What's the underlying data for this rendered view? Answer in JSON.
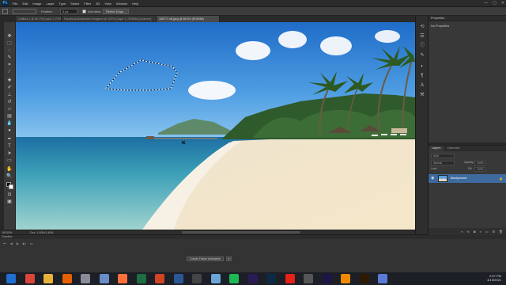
{
  "app": {
    "logo": "Ps",
    "menus": [
      "File",
      "Edit",
      "Image",
      "Layer",
      "Type",
      "Select",
      "Filter",
      "3D",
      "View",
      "Window",
      "Help"
    ],
    "window_controls": [
      "—",
      "▢",
      "✕"
    ]
  },
  "options_bar": {
    "feather_label": "Feather:",
    "feather_value": "0 px",
    "antialias_label": "Anti-alias",
    "refine_edge_label": "Refine Edge..."
  },
  "tabs": [
    {
      "label": "Untitled-1 @ 66.7% (Layer 1, RGB/8#)",
      "active": false
    },
    {
      "label": "Facebook-Bookmark-Designed @ 100% (Layer 1, RGB/8#) [Indexed]",
      "active": false
    },
    {
      "label": "168771 n$.jpeg @ 86.5% (RGB/8#)",
      "active": true
    }
  ],
  "status": {
    "zoom": "86.55%",
    "doc": "Doc: 1.40M/1.40M"
  },
  "timeline": {
    "title": "Timeline",
    "create_button": "Create Frame Animation",
    "controls": [
      "⏮",
      "◀",
      "▶",
      "▶|",
      "⏭"
    ]
  },
  "properties": {
    "title": "Properties",
    "subtitle": "No Properties"
  },
  "layers": {
    "tabs": [
      "Layers",
      "Channels"
    ],
    "kind_label": "Kind",
    "blend_mode": "Normal",
    "opacity_label": "Opacity:",
    "opacity_value": "100%",
    "lock_label": "Lock:",
    "fill_label": "Fill:",
    "fill_value": "100%",
    "layer_name": "Background"
  },
  "taskbar": {
    "time": "2:57 PM",
    "date": "4/19/2021",
    "apps": [
      {
        "icon": "start-icon",
        "color": "#1f6fd1"
      },
      {
        "icon": "chrome-icon",
        "color": "#db4437"
      },
      {
        "icon": "explorer-icon",
        "color": "#e8b23a"
      },
      {
        "icon": "firefox-icon",
        "color": "#e66000"
      },
      {
        "icon": "shield-icon",
        "color": "#8a8a9a"
      },
      {
        "icon": "notepad-icon",
        "color": "#6a8cc7"
      },
      {
        "icon": "firefox-icon",
        "color": "#ff7139"
      },
      {
        "icon": "excel-icon",
        "color": "#1d6f42"
      },
      {
        "icon": "powerpoint-icon",
        "color": "#d04423"
      },
      {
        "icon": "word-icon",
        "color": "#2b5797"
      },
      {
        "icon": "obs-icon",
        "color": "#444"
      },
      {
        "icon": "paint-icon",
        "color": "#6aa6d8"
      },
      {
        "icon": "spotify-icon",
        "color": "#1db954"
      },
      {
        "icon": "premiere-icon",
        "color": "#2a1a55"
      },
      {
        "icon": "photoshop-icon",
        "color": "#0d2a44"
      },
      {
        "icon": "youtube-icon",
        "color": "#e62117"
      },
      {
        "icon": "media-icon",
        "color": "#555"
      },
      {
        "icon": "aftereffects-icon",
        "color": "#1c1545"
      },
      {
        "icon": "vlc-icon",
        "color": "#f08a00"
      },
      {
        "icon": "illustrator-icon",
        "color": "#2e1a00"
      },
      {
        "icon": "app-icon",
        "color": "#5a7bd8"
      }
    ]
  }
}
